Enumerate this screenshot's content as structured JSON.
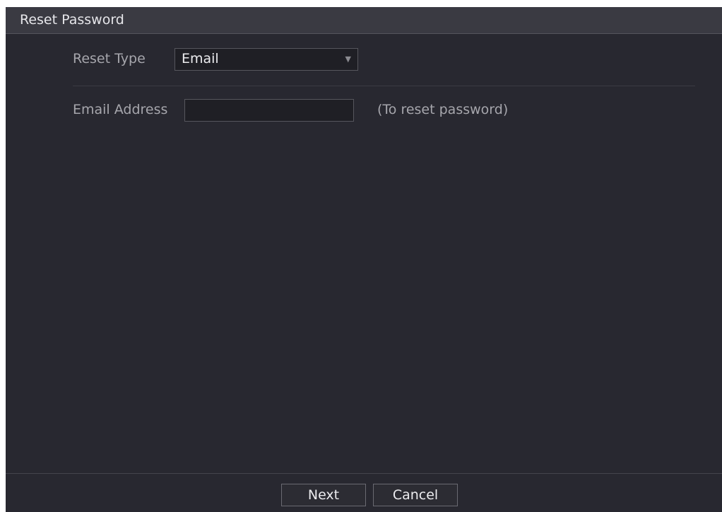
{
  "dialog": {
    "title": "Reset Password"
  },
  "form": {
    "reset_type_label": "Reset Type",
    "reset_type_value": "Email",
    "email_label": "Email Address",
    "email_value": "",
    "email_hint": "(To reset password)"
  },
  "footer": {
    "next_label": "Next",
    "cancel_label": "Cancel"
  },
  "colors": {
    "background": "#282830",
    "titlebar": "#3a3a42",
    "input_background": "#1f1f25",
    "border": "#56565d"
  },
  "icons": {
    "dropdown": "triangle-down-icon"
  }
}
